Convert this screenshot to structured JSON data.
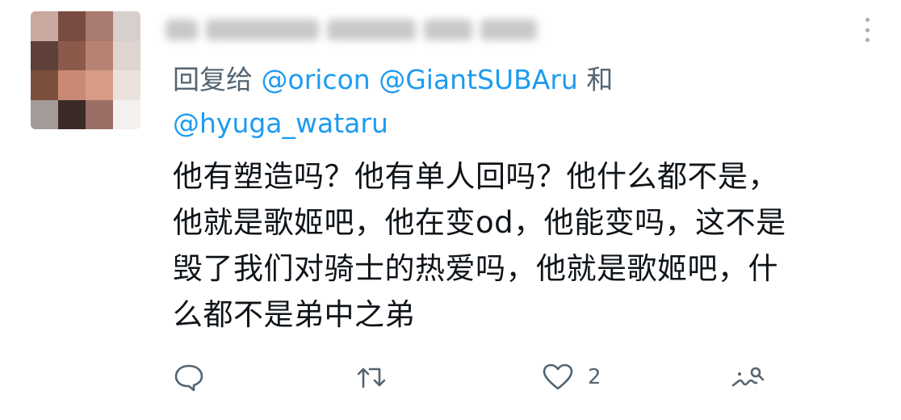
{
  "tweet": {
    "reply_label": "回复给",
    "mentions": [
      "@oricon",
      "@GiantSUBAru",
      "@hyuga_wataru"
    ],
    "conjunction": "和",
    "body": "他有塑造吗？他有单人回吗？他什么都不是，\n他就是歌姬吧，他在变od，他能变吗，这不是\n毁了我们对骑士的热爱吗，他就是歌姬吧，什\n么都不是弟中之弟",
    "like_count": "2"
  },
  "icons": {
    "reply": "reply-icon",
    "retweet": "retweet-icon",
    "like": "heart-icon",
    "share": "share-icon",
    "more": "more-icon"
  },
  "colors": {
    "mention": "#1d9bf0",
    "secondary": "#536471",
    "text": "#0f1419"
  }
}
